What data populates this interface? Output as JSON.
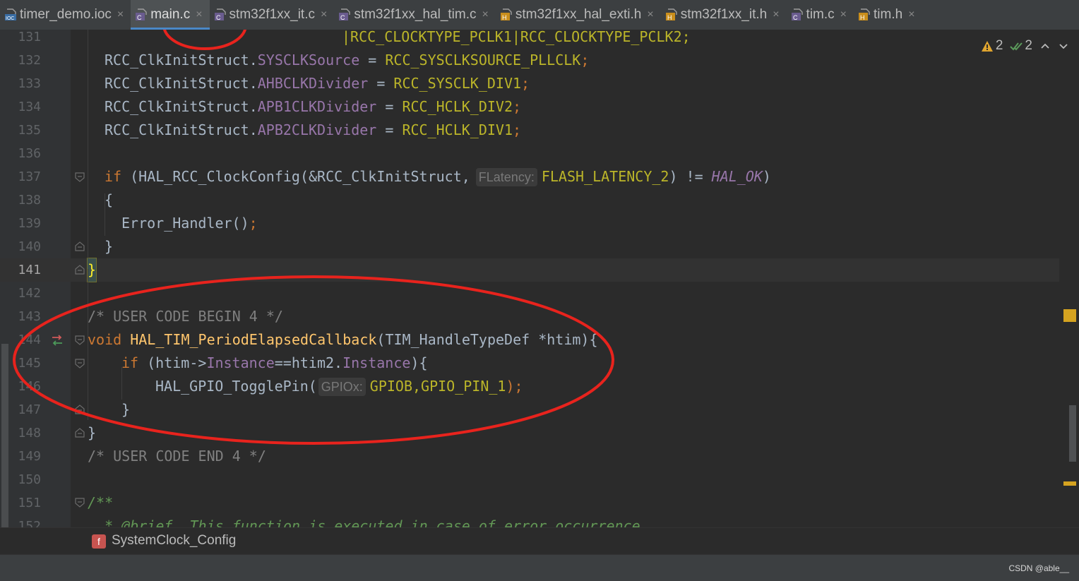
{
  "tabs": [
    {
      "label": "timer_demo.ioc",
      "icon": "ioc-file-icon",
      "active": false
    },
    {
      "label": "main.c",
      "icon": "c-file-icon",
      "active": true
    },
    {
      "label": "stm32f1xx_it.c",
      "icon": "c-file-icon",
      "active": false
    },
    {
      "label": "stm32f1xx_hal_tim.c",
      "icon": "c-file-icon",
      "active": false
    },
    {
      "label": "stm32f1xx_hal_exti.h",
      "icon": "h-file-icon",
      "active": false
    },
    {
      "label": "stm32f1xx_it.h",
      "icon": "h-file-icon",
      "active": false
    },
    {
      "label": "tim.c",
      "icon": "c-file-icon",
      "active": false
    },
    {
      "label": "tim.h",
      "icon": "h-file-icon",
      "active": false
    }
  ],
  "close_glyph": "×",
  "inspections": {
    "warnings": "2",
    "weak_warnings": "2"
  },
  "line_numbers": [
    "131",
    "132",
    "133",
    "134",
    "135",
    "136",
    "137",
    "138",
    "139",
    "140",
    "141",
    "142",
    "143",
    "144",
    "145",
    "146",
    "147",
    "148",
    "149",
    "150",
    "151",
    "152"
  ],
  "code": {
    "l131a": "|RCC_CLOCKTYPE_PCLK1|RCC_CLOCKTYPE_PCLK2;",
    "obj": "RCC_ClkInitStruct.",
    "f132": "SYSCLKSource",
    "v132": "RCC_SYSCLKSOURCE_PLLCLK",
    "f133": "AHBCLKDivider",
    "v133": "RCC_SYSCLK_DIV1",
    "f134": "APB1CLKDivider",
    "v134": "RCC_HCLK_DIV2",
    "f135": "APB2CLKDivider",
    "v135": "RCC_HCLK_DIV1",
    "if": "if",
    "call137": "(HAL_RCC_ClockConfig(&RCC_ClkInitStruct,",
    "hint137": "FLatency:",
    "arg137": "FLASH_LATENCY_2",
    "ne": ") != ",
    "ok": "HAL_OK",
    "close_paren": ")",
    "lbrace": "{",
    "rbrace": "}",
    "err": "Error_Handler()",
    "semi": ";",
    "c143": "/* USER CODE BEGIN 4 */",
    "void": "void",
    "fn144": "HAL_TIM_PeriodElapsedCallback",
    "params144": "(TIM_HandleTypeDef *htim){",
    "cond145a": "(htim->",
    "inst": "Instance",
    "cond145b": "==htim2.",
    "cond145c": "){",
    "toggle": "HAL_GPIO_TogglePin(",
    "hint146": "GPIOx:",
    "arg146": "GPIOB,GPIO_PIN_1",
    "end146": ");",
    "c149": "/* USER CODE END 4 */",
    "c151": "/**",
    "c152": "  * @brief  This function is executed in case of error occurrence."
  },
  "breadcrumb": {
    "badge": "f",
    "label": "SystemClock_Config"
  },
  "watermark": "CSDN @able__"
}
